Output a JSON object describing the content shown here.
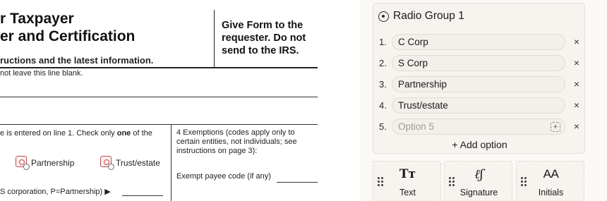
{
  "document": {
    "title_line_1": "r Taxpayer",
    "title_line_2": "er and Certification",
    "instructions_line": "ructions and the latest information.",
    "give_form": "Give Form to the requester. Do not send to the IRS.",
    "blank_note": "not leave this line blank.",
    "check_line_prefix": "e is entered on line 1. Check only ",
    "check_line_bold": "one",
    "check_line_suffix": " of the",
    "exemptions": "4  Exemptions (codes apply only to certain entities, not individuals; see instructions on page 3):",
    "radio_partnership": "Partnership",
    "radio_trust": "Trust/estate",
    "exempt_payee": "Exempt payee code (if any)",
    "scorp_line": "S corporation, P=Partnership) ▶"
  },
  "panel": {
    "group_title": "Radio Group 1",
    "options": [
      {
        "number": "1.",
        "value": "C Corp",
        "remove": "×"
      },
      {
        "number": "2.",
        "value": "S Corp",
        "remove": "×"
      },
      {
        "number": "3.",
        "value": "Partnership",
        "remove": "×"
      },
      {
        "number": "4.",
        "value": "Trust/estate",
        "remove": "×"
      },
      {
        "number": "5.",
        "placeholder": "Option 5",
        "remove": "×"
      }
    ],
    "add_option": "+ Add option",
    "tools": [
      {
        "icon_glyph": "Tᴛ",
        "icon": "text-icon",
        "label": "Text"
      },
      {
        "icon_glyph": "ℓʃ",
        "icon": "signature-icon",
        "label": "Signature"
      },
      {
        "icon_glyph": "AA",
        "icon": "initials-icon",
        "label": "Initials"
      }
    ]
  },
  "colors": {
    "document_radio_accent": "#c24a4a",
    "panel_background": "#fbf9f6",
    "card_background": "#f7f4f0"
  }
}
